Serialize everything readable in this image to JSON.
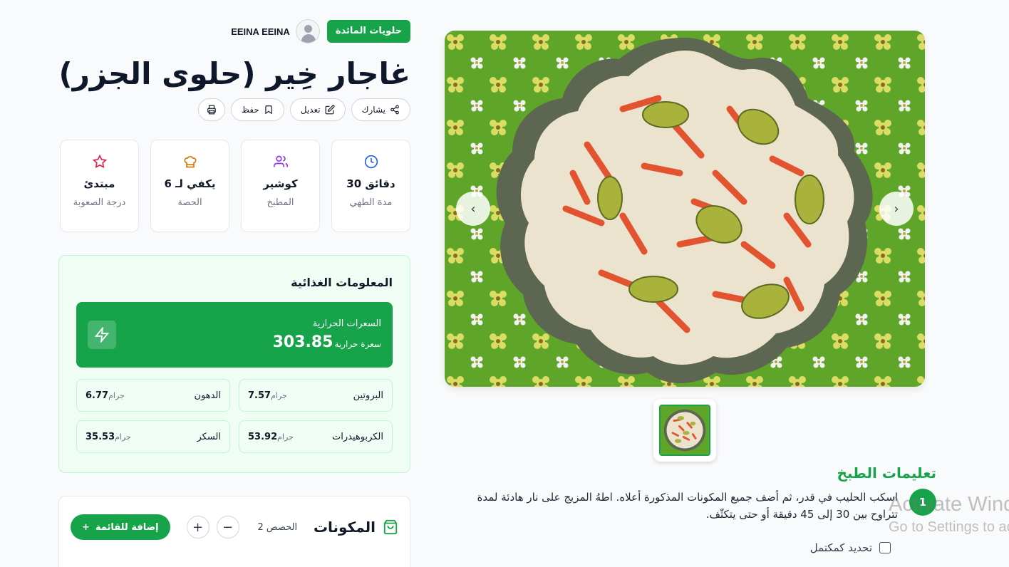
{
  "header": {
    "category": "حلويات المائدة",
    "author": "EEINA EEINA"
  },
  "recipe": {
    "title": "غاجار خِير (حلوى الجزر)"
  },
  "actions": {
    "share": "يشارك",
    "edit": "تعديل",
    "save": "حفظ"
  },
  "stats": [
    {
      "value": "30 دقائق",
      "label": "مدة الطهي",
      "icon": "clock-icon"
    },
    {
      "value": "كوشير",
      "label": "المطبخ",
      "icon": "users-icon"
    },
    {
      "value": "يكفي لـ 6",
      "label": "الحصة",
      "icon": "chef-hat-icon"
    },
    {
      "value": "مبتدئ",
      "label": "درجة الصعوبة",
      "icon": "star-icon"
    }
  ],
  "nutrition": {
    "title": "المعلومات الغذائية",
    "calories_label": "السعرات الحرارية",
    "calories_value": "303.85",
    "calories_unit": "سعرة حرارية",
    "items": [
      {
        "name": "البروتين",
        "value": "7.57",
        "unit": "جرام"
      },
      {
        "name": "الدهون",
        "value": "6.77",
        "unit": "جرام"
      },
      {
        "name": "الكربوهيدرات",
        "value": "53.92",
        "unit": "جرام"
      },
      {
        "name": "السكر",
        "value": "35.53",
        "unit": "جرام"
      }
    ]
  },
  "ingredients": {
    "title": "المكونات",
    "servings_label": "2 الحصص",
    "add_to_list": "إضافة للقائمة",
    "minus": "−",
    "plus": "+"
  },
  "gallery": {
    "prev": "‹",
    "next": "›"
  },
  "instructions": {
    "title": "تعليمات الطبخ",
    "steps": [
      {
        "number": "1",
        "text": "اسكب الحليب في قدر، ثم أضف جميع المكونات المذكورة أعلاه. اطهُ المزيج على نار هادئة لمدة تتراوح بين 30 إلى 45 دقيقة أو حتى يتكثّف."
      }
    ],
    "mark_done": "تحديد كمكتمل"
  },
  "watermark": {
    "line1": "Activate Windows",
    "line2": "Go to Settings to activate Windows."
  },
  "colors": {
    "primary": "#16a34a",
    "clock": "#2563eb",
    "users": "#9333ea",
    "chef": "#d97706",
    "star": "#e11d48"
  }
}
